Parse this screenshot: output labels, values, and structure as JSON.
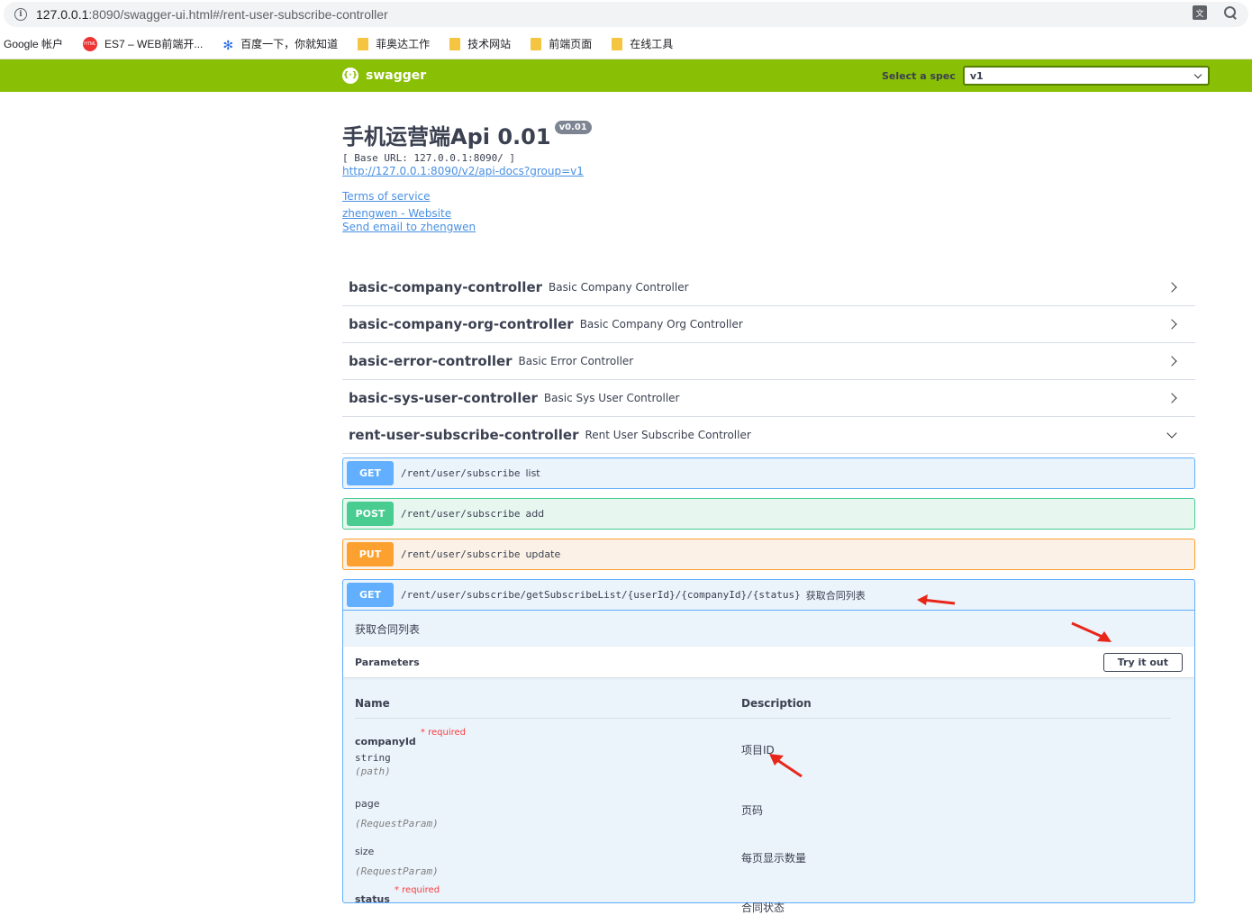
{
  "browser": {
    "url_host": "127.0.0.1",
    "url_rest": ":8090/swagger-ui.html#/rent-user-subscribe-controller",
    "bookmarks": [
      {
        "label": "Google 帐户"
      },
      {
        "label": "ES7 – WEB前端开..."
      },
      {
        "label": "百度一下，你就知道"
      },
      {
        "label": "菲奥达工作"
      },
      {
        "label": "技术网站"
      },
      {
        "label": "前端页面"
      },
      {
        "label": "在线工具"
      }
    ]
  },
  "topbar": {
    "logo": "swagger",
    "spec_label": "Select a spec",
    "spec_value": "v1"
  },
  "info": {
    "title": "手机运营端Api 0.01",
    "version": "v0.01",
    "base_url": "[ Base URL: 127.0.0.1:8090/ ]",
    "docs_link": "http://127.0.0.1:8090/v2/api-docs?group=v1",
    "terms": "Terms of service",
    "website": "zhengwen - Website",
    "email": "Send email to zhengwen"
  },
  "tags": [
    {
      "name": "basic-company-controller",
      "desc": "Basic Company Controller"
    },
    {
      "name": "basic-company-org-controller",
      "desc": "Basic Company Org Controller"
    },
    {
      "name": "basic-error-controller",
      "desc": "Basic Error Controller"
    },
    {
      "name": "basic-sys-user-controller",
      "desc": "Basic Sys User Controller"
    },
    {
      "name": "rent-user-subscribe-controller",
      "desc": "Rent User Subscribe Controller"
    }
  ],
  "operations": [
    {
      "method": "GET",
      "path": "/rent/user/subscribe",
      "summary": "list"
    },
    {
      "method": "POST",
      "path": "/rent/user/subscribe",
      "summary": "add"
    },
    {
      "method": "PUT",
      "path": "/rent/user/subscribe",
      "summary": "update"
    }
  ],
  "expanded": {
    "method": "GET",
    "path": "/rent/user/subscribe/getSubscribeList/{userId}/{companyId}/{status}",
    "summary": "获取合同列表",
    "description": "获取合同列表",
    "params_title": "Parameters",
    "try_label": "Try it out",
    "col_name": "Name",
    "col_desc": "Description",
    "params": [
      {
        "name": "companyId",
        "required": "* required",
        "type": "string",
        "in": "(path)",
        "desc": "项目ID"
      },
      {
        "name": "page",
        "required": "",
        "type": "",
        "in": "(RequestParam)",
        "desc": "页码"
      },
      {
        "name": "size",
        "required": "",
        "type": "",
        "in": "(RequestParam)",
        "desc": "每页显示数量"
      },
      {
        "name": "status",
        "required": "* required",
        "type": "",
        "in": "",
        "desc": "合同状态"
      }
    ]
  },
  "colors": {
    "topbar": "#89bf04",
    "get": "#61affe",
    "post": "#49cc90",
    "put": "#fca130",
    "annotation_arrow": "#e8261a"
  }
}
